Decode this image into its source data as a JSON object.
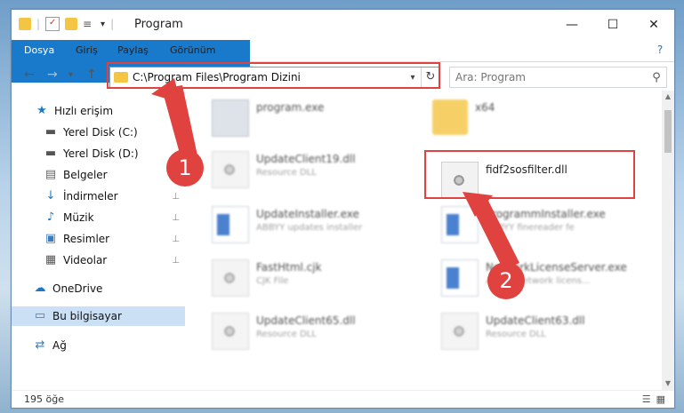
{
  "window": {
    "title": "Program",
    "minimize": "—",
    "maximize": "☐",
    "close": "✕"
  },
  "ribbon": {
    "tabs": [
      "Dosya",
      "Giriş",
      "Paylaş",
      "Görünüm"
    ],
    "help": "?"
  },
  "nav": {
    "back": "←",
    "forward": "→",
    "recent": "▾",
    "up": "↑",
    "address": "C:\\Program Files\\Program Dizini",
    "dropdown": "▾",
    "refresh": "↻",
    "search_placeholder": "Ara: Program"
  },
  "sidebar": {
    "items": [
      {
        "label": "Hızlı erişim",
        "icon": "★"
      },
      {
        "label": "Yerel Disk (C:)",
        "icon": "▬"
      },
      {
        "label": "Yerel Disk (D:)",
        "icon": "▬"
      },
      {
        "label": "Belgeler",
        "icon": "▤"
      },
      {
        "label": "İndirmeler",
        "icon": "↓"
      },
      {
        "label": "Müzik",
        "icon": "♪"
      },
      {
        "label": "Resimler",
        "icon": "▣"
      },
      {
        "label": "Videolar",
        "icon": "▦"
      },
      {
        "label": "OneDrive",
        "icon": "☁"
      },
      {
        "label": "Bu bilgisayar",
        "icon": "▭"
      },
      {
        "label": "Ağ",
        "icon": "⇄"
      }
    ],
    "pin": "📌"
  },
  "files": [
    {
      "name": "program.exe",
      "sub": ""
    },
    {
      "name": "x64",
      "sub": ""
    },
    {
      "name": "UpdateClient19.dll",
      "sub": "Resource DLL"
    },
    {
      "name": "fidf2sosfilter.dll",
      "sub": ""
    },
    {
      "name": "UpdateInstaller.exe",
      "sub": "ABBYY updates installer"
    },
    {
      "name": "ProgrammInstaller.exe",
      "sub": "ABBYY finereader fe"
    },
    {
      "name": "FastHtml.cjk",
      "sub": "CJK File"
    },
    {
      "name": "NetworkLicenseServer.exe",
      "sub": "ABBYY network licens..."
    },
    {
      "name": "UpdateClient65.dll",
      "sub": "Resource DLL"
    },
    {
      "name": "UpdateClient63.dll",
      "sub": "Resource DLL"
    }
  ],
  "status": {
    "count": "195 öğe",
    "view_details": "☰",
    "view_icons": "▦"
  },
  "annotations": {
    "badge1": "1",
    "badge2": "2",
    "accent": "#e0423f"
  }
}
